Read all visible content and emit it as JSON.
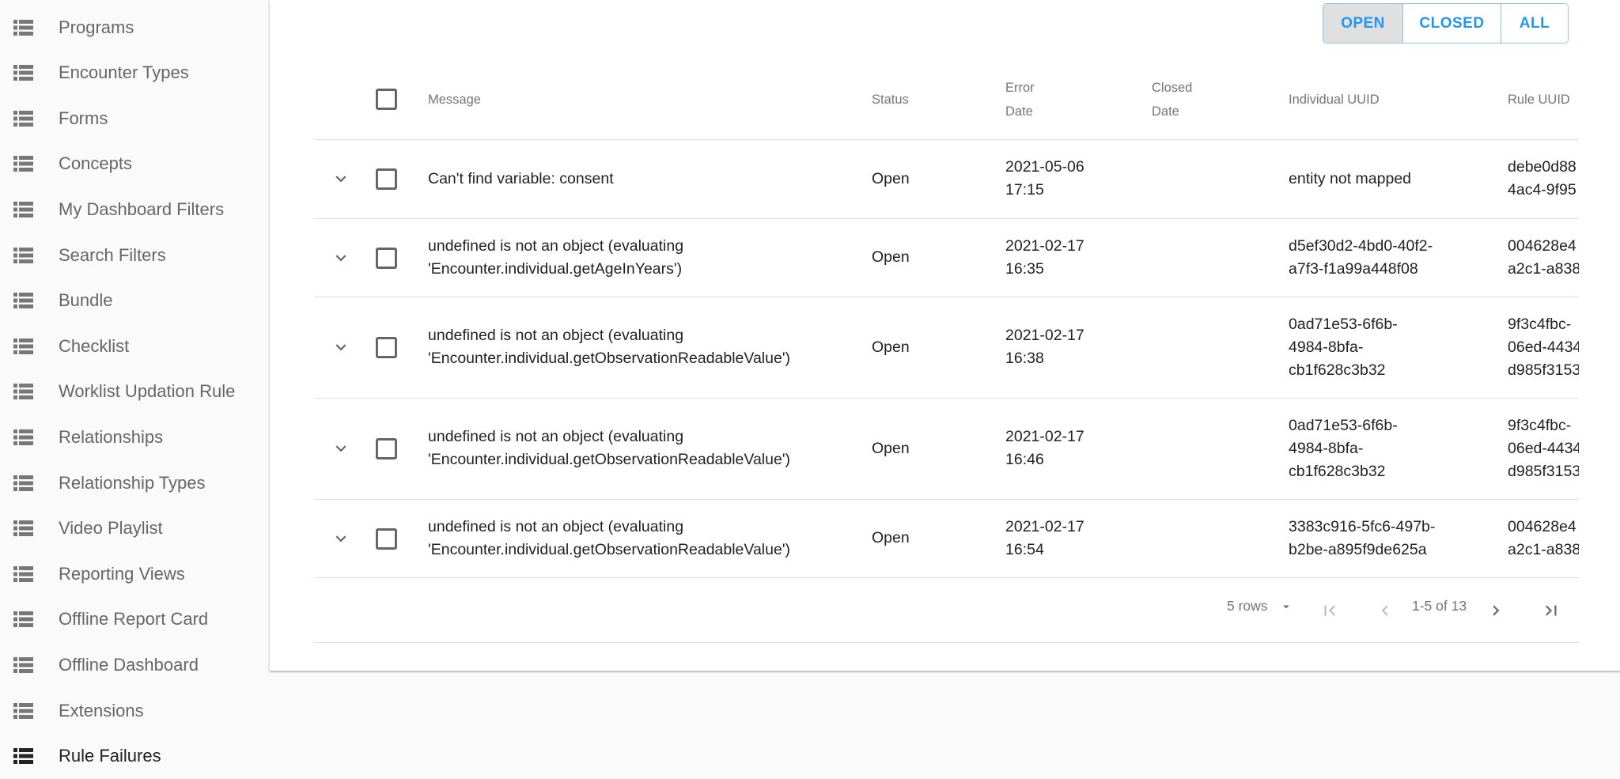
{
  "sidebar": {
    "items": [
      {
        "label": "Programs",
        "icon": "list-icon",
        "active": false
      },
      {
        "label": "Encounter Types",
        "icon": "list-icon",
        "active": false
      },
      {
        "label": "Forms",
        "icon": "list-icon",
        "active": false
      },
      {
        "label": "Concepts",
        "icon": "list-icon",
        "active": false
      },
      {
        "label": "My Dashboard Filters",
        "icon": "list-icon",
        "active": false
      },
      {
        "label": "Search Filters",
        "icon": "list-icon",
        "active": false
      },
      {
        "label": "Bundle",
        "icon": "list-icon",
        "active": false
      },
      {
        "label": "Checklist",
        "icon": "list-icon",
        "active": false
      },
      {
        "label": "Worklist Updation Rule",
        "icon": "list-icon",
        "active": false
      },
      {
        "label": "Relationships",
        "icon": "list-icon",
        "active": false
      },
      {
        "label": "Relationship Types",
        "icon": "list-icon",
        "active": false
      },
      {
        "label": "Video Playlist",
        "icon": "list-icon",
        "active": false
      },
      {
        "label": "Reporting Views",
        "icon": "list-icon",
        "active": false
      },
      {
        "label": "Offline Report Card",
        "icon": "list-icon",
        "active": false
      },
      {
        "label": "Offline Dashboard",
        "icon": "list-icon",
        "active": false
      },
      {
        "label": "Extensions",
        "icon": "list-icon",
        "active": false
      },
      {
        "label": "Rule Failures",
        "icon": "list-icon",
        "active": true
      }
    ]
  },
  "filter_toggle": {
    "options": [
      "OPEN",
      "CLOSED",
      "ALL"
    ],
    "selected": "OPEN",
    "accent_color": "#2196f3"
  },
  "table": {
    "columns": {
      "message": "Message",
      "status": "Status",
      "error_date_line1": "Error",
      "error_date_line2": "Date",
      "closed_date_line1": "Closed",
      "closed_date_line2": "Date",
      "individual_uuid": "Individual UUID",
      "rule_uuid": "Rule UUID"
    },
    "rows": [
      {
        "message": [
          "Can't find variable: consent"
        ],
        "status": "Open",
        "error_date": [
          "2021-05-06",
          "17:15"
        ],
        "closed_date": "",
        "individual_uuid": [
          "entity not mapped"
        ],
        "rule_uuid": [
          "debe0d88",
          "4ac4-9f95"
        ]
      },
      {
        "message": [
          "undefined is not an object (evaluating",
          "'Encounter.individual.getAgeInYears')"
        ],
        "status": "Open",
        "error_date": [
          "2021-02-17",
          "16:35"
        ],
        "closed_date": "",
        "individual_uuid": [
          "d5ef30d2-4bd0-40f2-",
          "a7f3-f1a99a448f08"
        ],
        "rule_uuid": [
          "004628e4",
          "a2c1-a838"
        ]
      },
      {
        "message": [
          "undefined is not an object (evaluating",
          "'Encounter.individual.getObservationReadableValue')"
        ],
        "status": "Open",
        "error_date": [
          "2021-02-17",
          "16:38"
        ],
        "closed_date": "",
        "individual_uuid": [
          "0ad71e53-6f6b-",
          "4984-8bfa-",
          "cb1f628c3b32"
        ],
        "rule_uuid": [
          "9f3c4fbc-",
          "06ed-4434",
          "d985f3153"
        ]
      },
      {
        "message": [
          "undefined is not an object (evaluating",
          "'Encounter.individual.getObservationReadableValue')"
        ],
        "status": "Open",
        "error_date": [
          "2021-02-17",
          "16:46"
        ],
        "closed_date": "",
        "individual_uuid": [
          "0ad71e53-6f6b-",
          "4984-8bfa-",
          "cb1f628c3b32"
        ],
        "rule_uuid": [
          "9f3c4fbc-",
          "06ed-4434",
          "d985f3153"
        ]
      },
      {
        "message": [
          "undefined is not an object (evaluating",
          "'Encounter.individual.getObservationReadableValue')"
        ],
        "status": "Open",
        "error_date": [
          "2021-02-17",
          "16:54"
        ],
        "closed_date": "",
        "individual_uuid": [
          "3383c916-5fc6-497b-",
          "b2be-a895f9de625a"
        ],
        "rule_uuid": [
          "004628e4",
          "a2c1-a838"
        ]
      }
    ]
  },
  "pagination": {
    "rows_per_page": "5 rows",
    "range_label": "1-5 of 13",
    "first_page_enabled": false,
    "prev_page_enabled": false,
    "next_page_enabled": true,
    "last_page_enabled": true
  }
}
